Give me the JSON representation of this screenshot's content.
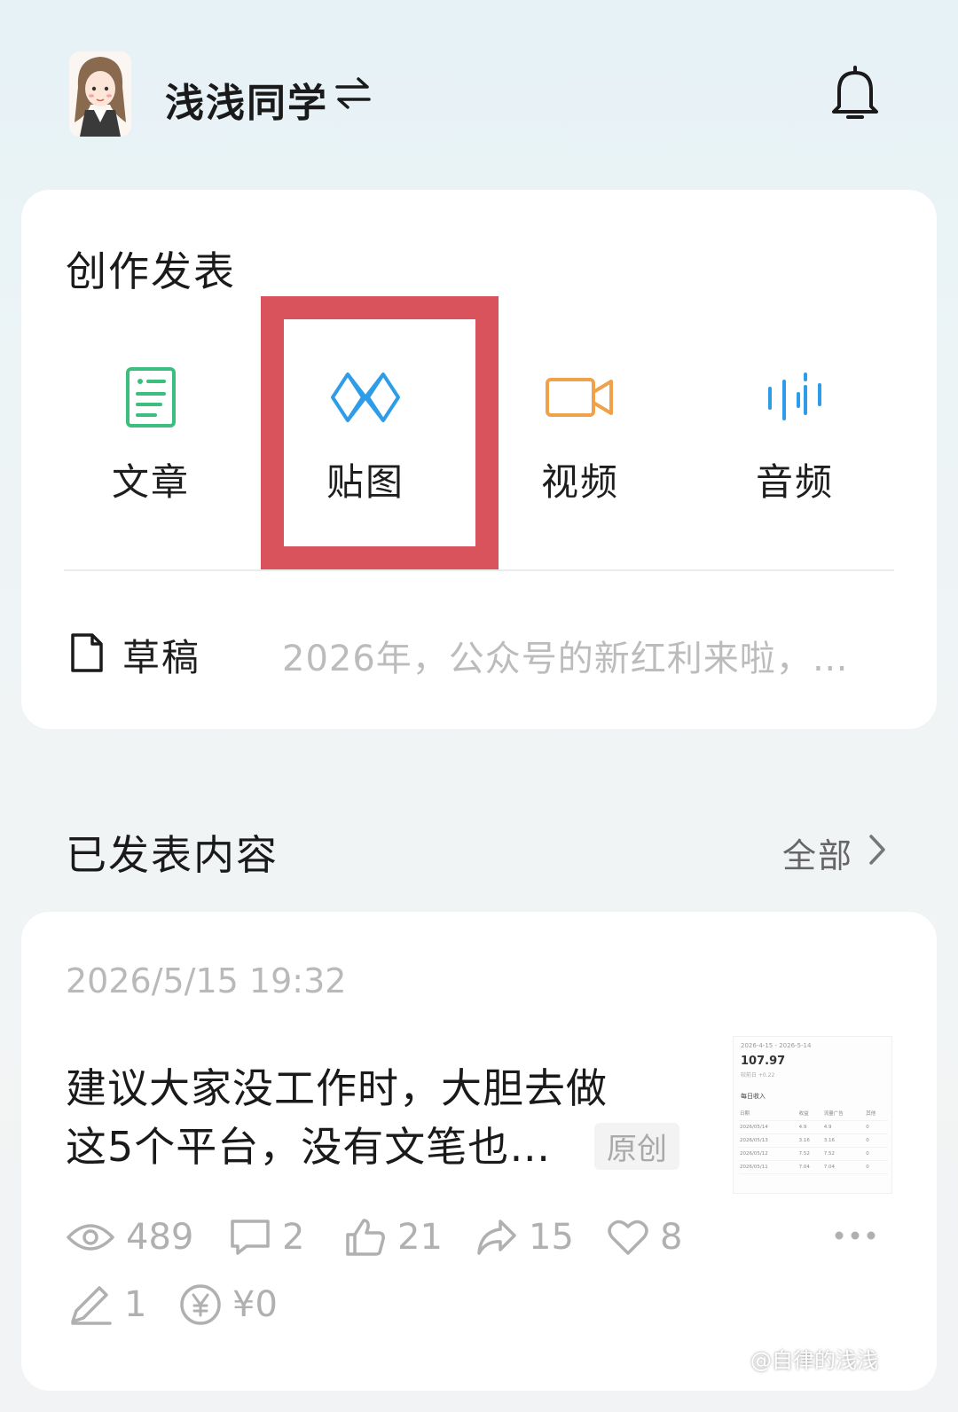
{
  "header": {
    "username": "浅浅同学",
    "switch_icon": "switch-account-icon",
    "notification_icon": "bell-icon"
  },
  "create": {
    "title": "创作发表",
    "tools": [
      {
        "label": "文章",
        "icon": "article-icon",
        "color": "#3cbf7e"
      },
      {
        "label": "贴图",
        "icon": "image-post-icon",
        "color": "#2f9ce8"
      },
      {
        "label": "视频",
        "icon": "video-icon",
        "color": "#f0a24a"
      },
      {
        "label": "音频",
        "icon": "audio-icon",
        "color": "#2f9ce8"
      }
    ],
    "highlight_color": "#d8535b",
    "draft": {
      "label": "草稿",
      "preview": "2026年，公众号的新红利来啦，…",
      "more": "⋯"
    }
  },
  "published": {
    "title": "已发表内容",
    "all_label": "全部",
    "post": {
      "time": "2026/5/15 19:32",
      "title_line1": "建议大家没工作时，大胆去做",
      "title_line2": "这5个平台，没有文笔也…",
      "badge": "原创",
      "thumbnail": {
        "range": "2026-4-15 - 2026-5-14",
        "value": "107.97",
        "sub": "较前日 +0.22",
        "heading": "每日收入",
        "columns": [
          "日期",
          "收益",
          "流量广告",
          "其他"
        ],
        "rows": [
          [
            "2026/05/14",
            "4.9",
            "4.9",
            "0"
          ],
          [
            "2026/05/13",
            "3.16",
            "3.16",
            "0"
          ],
          [
            "2026/05/12",
            "7.52",
            "7.52",
            "0"
          ],
          [
            "2026/05/11",
            "7.04",
            "7.04",
            "0"
          ]
        ]
      },
      "stats": {
        "views": "489",
        "comments": "2",
        "likes": "21",
        "shares": "15",
        "favorites": "8",
        "edits": "1",
        "earnings": "¥0"
      }
    }
  },
  "watermark": "@自律的浅浅"
}
